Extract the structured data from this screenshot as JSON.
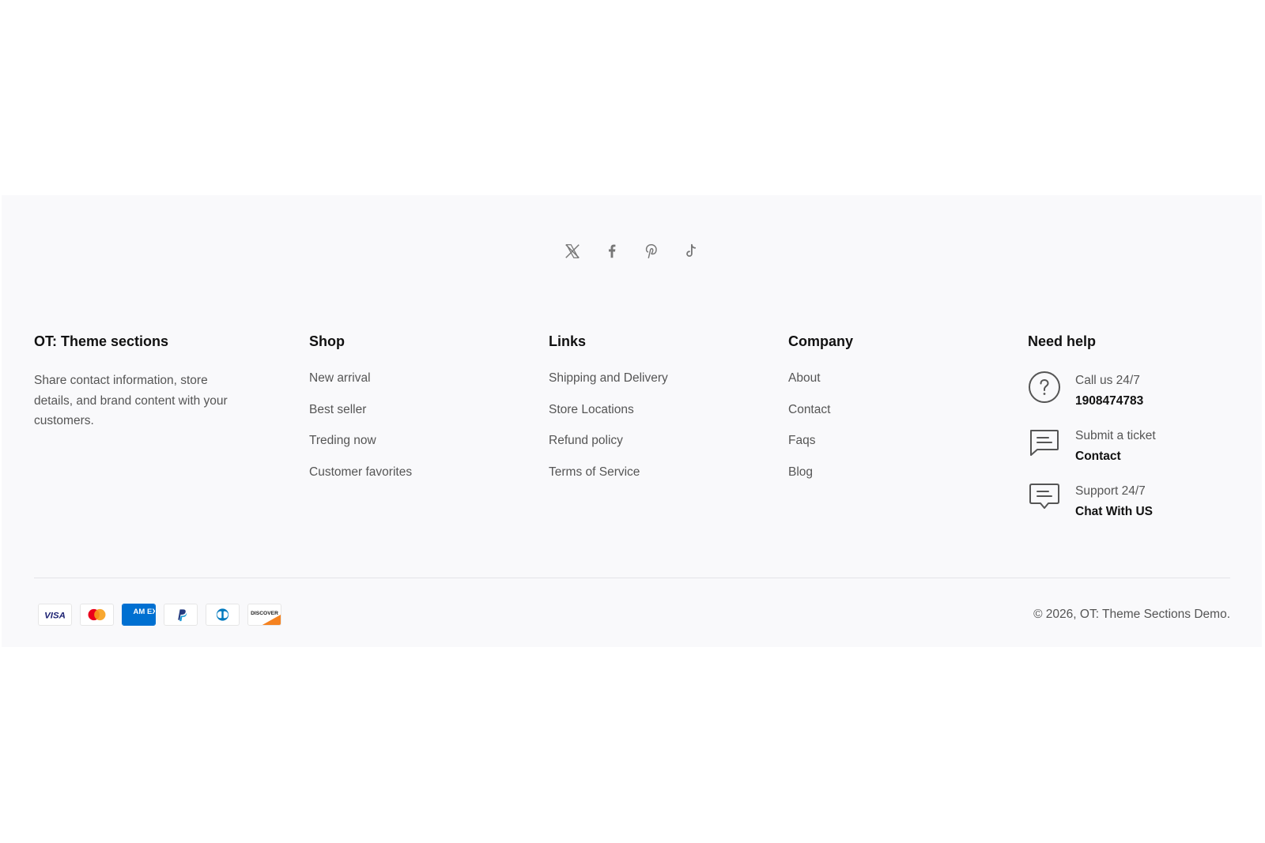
{
  "social": {
    "icons": [
      "x-twitter-icon",
      "facebook-icon",
      "pinterest-icon",
      "tiktok-icon"
    ]
  },
  "brand": {
    "title": "OT: Theme sections",
    "description": "Share contact information, store details, and brand content with your customers."
  },
  "shop": {
    "title": "Shop",
    "items": [
      "New arrival",
      "Best seller",
      "Treding now",
      "Customer favorites"
    ]
  },
  "links": {
    "title": "Links",
    "items": [
      "Shipping and Delivery",
      "Store Locations",
      "Refund policy",
      "Terms of Service"
    ]
  },
  "company": {
    "title": "Company",
    "items": [
      "About",
      "Contact",
      "Faqs",
      "Blog"
    ]
  },
  "help": {
    "title": "Need help",
    "items": [
      {
        "icon": "question-circle-icon",
        "label": "Call us 24/7",
        "value": "1908474783"
      },
      {
        "icon": "message-square-icon",
        "label": "Submit a ticket",
        "value": "Contact"
      },
      {
        "icon": "chat-bubble-icon",
        "label": "Support 24/7",
        "value": "Chat With US"
      }
    ]
  },
  "payments": {
    "methods": [
      "visa",
      "mastercard",
      "american-express",
      "paypal",
      "diners-club",
      "discover"
    ],
    "visa_text": "VISA",
    "amex_text": "AM EX",
    "discover_text": "DISCOVER",
    "colors": {
      "visa": "#1a1f71",
      "mc_red": "#eb001b",
      "mc_orange": "#f79e1b",
      "amex": "#0070d1",
      "paypal": "#253b80",
      "diners": "#0079be",
      "discover": "#f58220"
    }
  },
  "copyright": "© 2026, OT: Theme Sections Demo.",
  "colors": {
    "footer_bg": "#f9f9fb",
    "text_muted": "#555555",
    "heading": "#111111",
    "icon": "#777777"
  }
}
